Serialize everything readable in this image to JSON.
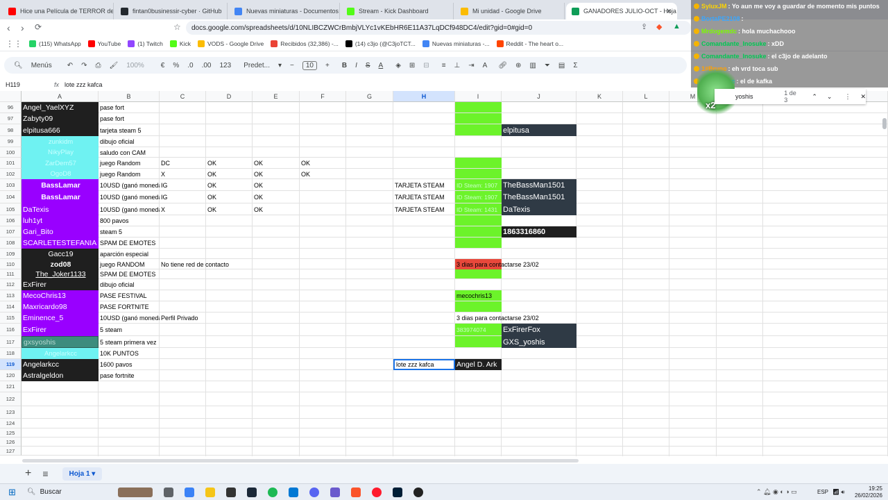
{
  "browser": {
    "tabs": [
      {
        "label": "Hice una Película de TERROR de $1",
        "color": "#ff0000"
      },
      {
        "label": "fintan0businessir-cyber · GitHub",
        "color": "#24292f"
      },
      {
        "label": "Nuevas miniaturas - Documentos de",
        "color": "#4285f4"
      },
      {
        "label": "Stream - Kick Dashboard",
        "color": "#53fc18"
      },
      {
        "label": "Mi unidad - Google Drive",
        "color": "#fbbc04"
      },
      {
        "label": "GANADORES JULIO-OCT - Hoja",
        "color": "#0f9d58"
      }
    ],
    "url": "docs.google.com/spreadsheets/d/10NLIBCZWCrBmbjVLYc1vKEbHR6E11A37LqDCf948DC4/edit?gid=0#gid=0",
    "bookmarks": [
      {
        "label": "(115) WhatsApp",
        "color": "#25d366"
      },
      {
        "label": "YouTube",
        "color": "#ff0000"
      },
      {
        "label": "(1) Twitch",
        "color": "#9146ff"
      },
      {
        "label": "Kick",
        "color": "#53fc18"
      },
      {
        "label": "VODS - Google Drive",
        "color": "#fbbc04"
      },
      {
        "label": "Recibidos (32,386) -...",
        "color": "#ea4335"
      },
      {
        "label": "(14) c3jo (@C3joTCT...",
        "color": "#000000"
      },
      {
        "label": "Nuevas miniaturas -...",
        "color": "#4285f4"
      },
      {
        "label": "Reddit - The heart o...",
        "color": "#ff4500"
      }
    ]
  },
  "toolbar": {
    "menus_label": "Menús",
    "zoom": "100%",
    "currency": "€",
    "percent": "%",
    "dec_dec": ".0",
    "inc_dec": ".00",
    "num_format": "123",
    "font": "Predet...",
    "font_size": "10"
  },
  "formula": {
    "cell_ref": "H119",
    "fx": "fx",
    "value": "lote zzz kafca"
  },
  "columns": [
    "A",
    "B",
    "C",
    "D",
    "E",
    "F",
    "G",
    "H",
    "I",
    "J",
    "K",
    "L",
    "M",
    "N",
    "O"
  ],
  "rows": [
    {
      "num": "96",
      "A": "Angel_YaelXYZ",
      "B": "pase fort"
    },
    {
      "num": "97",
      "A": "Zabyty09",
      "B": "pase fort"
    },
    {
      "num": "98",
      "A": "elpitusa666",
      "B": "tarjeta steam 5",
      "J": "elpitusa"
    },
    {
      "num": "99",
      "A": "zunkidm",
      "B": "dibujo oficial"
    },
    {
      "num": "100",
      "A": "NikyPlay",
      "B": "saludo con CAM"
    },
    {
      "num": "101",
      "A": "ZarDem57",
      "B": "juego Random",
      "C": "DC",
      "D": "OK",
      "E": "OK",
      "F": "OK"
    },
    {
      "num": "102",
      "A": "OgoD8",
      "B": "juego Random",
      "C": "X",
      "D": "OK",
      "E": "OK",
      "F": "OK"
    },
    {
      "num": "103",
      "A": "BassLamar",
      "B": "10USD (ganó moneda)",
      "C": "IG",
      "D": "OK",
      "E": "OK",
      "H": "TARJETA STEAM",
      "I": "ID Steam: 1907",
      "J": "TheBassMan1501"
    },
    {
      "num": "104",
      "A": "BassLamar",
      "B": "10USD (ganó moneda)",
      "C": "IG",
      "D": "OK",
      "E": "OK",
      "H": "TARJETA STEAM",
      "I": "ID Steam: 1907",
      "J": "TheBassMan1501"
    },
    {
      "num": "105",
      "A": "DaTexis",
      "B": "10USD (ganó moneda)",
      "C": "X",
      "D": "OK",
      "E": "OK",
      "H": "TARJETA STEAM",
      "I": "ID Steam: 1431",
      "J": "DaTexis"
    },
    {
      "num": "106",
      "A": "luh1yt",
      "B": "800 pavos"
    },
    {
      "num": "107",
      "A": "Gari_Bito",
      "B": "steam 5",
      "J": "1863316860"
    },
    {
      "num": "108",
      "A": "SCARLETESTEFANIA",
      "B": "SPAM DE EMOTES"
    },
    {
      "num": "109",
      "A": "Gacc19",
      "B": "aparción especial"
    },
    {
      "num": "110",
      "A": "zod08",
      "B": "juego RANDOM",
      "C": "No tiene red de contacto",
      "I": "3 dias para contactarse 23/02"
    },
    {
      "num": "111",
      "A": "The_Joker1133",
      "B": "SPAM DE EMOTES"
    },
    {
      "num": "112",
      "A": "ExFirer",
      "B": "dibujo oficial"
    },
    {
      "num": "113",
      "A": "MecoChris13",
      "B": "PASE FESTIVAL",
      "I": "mecochris13"
    },
    {
      "num": "114",
      "A": "Maxricardo98",
      "B": "PASE FORTNITE"
    },
    {
      "num": "115",
      "A": "Eminence_5",
      "B": "10USD (ganó moneda)",
      "C": "Perfil Privado",
      "I": "3 dias para contactarse 23/02"
    },
    {
      "num": "116",
      "A": "ExFirer",
      "B": "5 steam",
      "I": "383974074",
      "J": "ExFirerFox"
    },
    {
      "num": "117",
      "A": "gxsyoshis",
      "B": "5 steam primera vez",
      "J": "GXS_yoshis"
    },
    {
      "num": "118",
      "A": "Angelarkcc",
      "B": "10K PUNTOS"
    },
    {
      "num": "119",
      "A": "Angelarkcc",
      "B": "1600 pavos",
      "H": "lote zzz kafca",
      "I": "Angel D. Ark"
    },
    {
      "num": "120",
      "A": "Astralgeldon",
      "B": "pase fortnite"
    },
    {
      "num": "121"
    },
    {
      "num": "122"
    },
    {
      "num": "123"
    },
    {
      "num": "124"
    },
    {
      "num": "125"
    },
    {
      "num": "126"
    },
    {
      "num": "127"
    }
  ],
  "find": {
    "query": "yoshis",
    "count": "1 de 3"
  },
  "chat": [
    {
      "user": "SyluxJM",
      "msg": ": Yo aun me voy a guardar de momento mis puntos",
      "color": "#ffd400"
    },
    {
      "user": "BortaPE2108",
      "msg": ":",
      "color": "#3aa7ff"
    },
    {
      "user": "Mrdogemdc",
      "msg": ": hola muchachooo",
      "color": "#7CFC00"
    },
    {
      "user": "Comandante_Inosuke",
      "msg": ": xDD",
      "color": "#00c853"
    },
    {
      "user": "Comandante_Inosuke",
      "msg": ": el c3jo de adelanto",
      "color": "#00c853"
    },
    {
      "user": "1#Bruno",
      "msg": ": eh vrd toca sub",
      "color": "#ffa000"
    },
    {
      "user": "Angelarkcc",
      "msg": ": el de kafka",
      "color": "#00b0ff"
    }
  ],
  "chat_overlay": "x2",
  "sheet_tab": "Hoja 1",
  "taskbar": {
    "search": "Buscar",
    "lang": "ESP",
    "time": "19:25",
    "date": "26/02/2026"
  }
}
